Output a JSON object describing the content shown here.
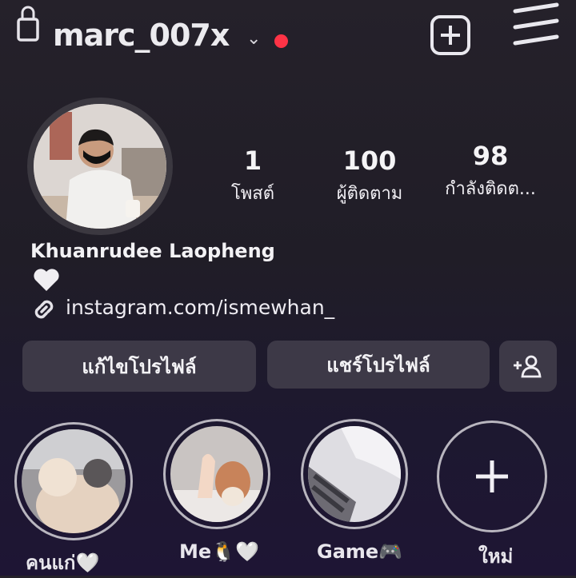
{
  "header": {
    "username": "marc_007x",
    "notification_dot_color": "#ff3346"
  },
  "stats": [
    {
      "value": "1",
      "label": "โพสต์"
    },
    {
      "value": "100",
      "label": "ผู้ติดตาม"
    },
    {
      "value": "98",
      "label": "กำลังติดต..."
    }
  ],
  "profile": {
    "name": "Khuanrudee Laopheng",
    "bio_emoji": "🤍",
    "link": "instagram.com/ismewhan_"
  },
  "buttons": {
    "edit_profile": "แก้ไขโปรไฟล์",
    "share_profile": "แชร์โปรไฟล์"
  },
  "highlights": [
    {
      "label": "คนแก่🤍"
    },
    {
      "label": "Me🐧🤍"
    },
    {
      "label": "Game🎮"
    },
    {
      "label": "ใหม่"
    }
  ]
}
